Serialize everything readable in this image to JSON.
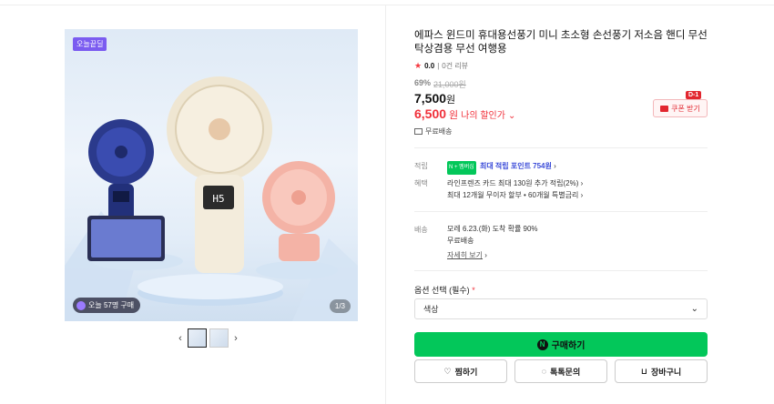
{
  "gallery": {
    "badge": "오늘끝딜",
    "buyers_text": "오늘 57명 구매",
    "counter": "1/3"
  },
  "product": {
    "title": "에파스 윈드미 휴대용선풍기 미니 초소형 손선풍기 저소음 핸디 무선 탁상겸용 무선 여행용",
    "rating": "0.0",
    "reviews": "0건 리뷰",
    "discount_pct": "69%",
    "original_price": "21,000원",
    "price": "7,500",
    "price_unit": "원",
    "my_price": "6,500",
    "my_price_unit": "원",
    "my_price_label": "나의 할인가",
    "coupon_label": "쿠폰 받기",
    "dday": "D-1",
    "shipping_free": "무료배송"
  },
  "benefits": {
    "points_label": "적립",
    "npay_badge": "N + 멤버십",
    "points_text": "최대 적립 포인트 754원",
    "perks_label": "혜택",
    "perks_line1": "라인프렌즈 카드 최대 130원 추가 적립(2%)",
    "perks_line2": "최대 12개월 무이자 할부 • 60개월 특별금리"
  },
  "delivery": {
    "label": "배송",
    "line1": "모레 6.23.(화) 도착 확률 90%",
    "line2": "무료배송",
    "more": "자세히 보기"
  },
  "options": {
    "label": "옵션 선택 (필수)",
    "select_value": "색상"
  },
  "actions": {
    "buy": "구매하기",
    "wish": "찜하기",
    "talk": "톡톡문의",
    "cart": "장바구니"
  }
}
